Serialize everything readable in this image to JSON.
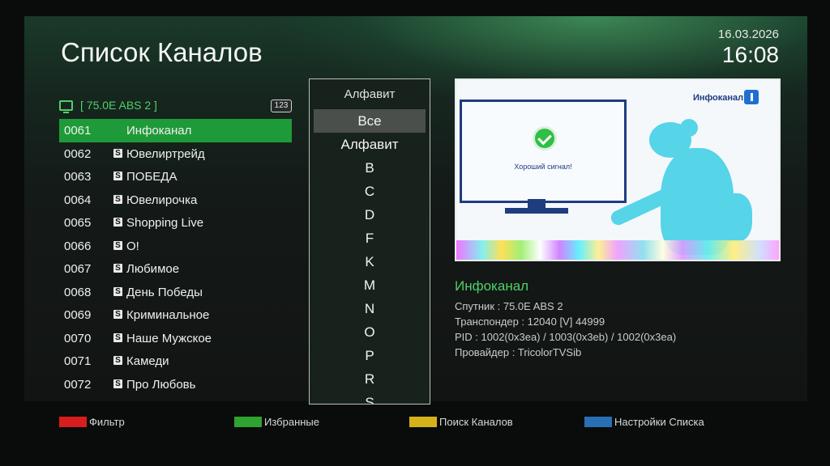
{
  "header": {
    "title": "Список Каналов",
    "date": "16.03.2026",
    "time": "16:08"
  },
  "satellite": {
    "label": "[ 75.0E ABS 2 ]",
    "badge": "123"
  },
  "channels": [
    {
      "num": "0061",
      "name": "Инфоканал",
      "scrambled": false,
      "selected": true
    },
    {
      "num": "0062",
      "name": "Ювелиртрейд",
      "scrambled": true
    },
    {
      "num": "0063",
      "name": "ПОБЕДА",
      "scrambled": true
    },
    {
      "num": "0064",
      "name": "Ювелирочка",
      "scrambled": true
    },
    {
      "num": "0065",
      "name": "Shopping Live",
      "scrambled": true
    },
    {
      "num": "0066",
      "name": "О!",
      "scrambled": true
    },
    {
      "num": "0067",
      "name": "Любимое",
      "scrambled": true
    },
    {
      "num": "0068",
      "name": "День Победы",
      "scrambled": true
    },
    {
      "num": "0069",
      "name": "Криминальное",
      "scrambled": true
    },
    {
      "num": "0070",
      "name": "Наше Мужское",
      "scrambled": true
    },
    {
      "num": "0071",
      "name": "Камеди",
      "scrambled": true
    },
    {
      "num": "0072",
      "name": "Про Любовь",
      "scrambled": true
    }
  ],
  "scramble_icon_label": "S",
  "alphabet": {
    "title": "Алфавит",
    "items": [
      "Все",
      "Алфавит",
      "B",
      "C",
      "D",
      "F",
      "K",
      "M",
      "N",
      "O",
      "P",
      "R",
      "S"
    ],
    "selected_index": 0
  },
  "preview": {
    "logo_text": "Инфоканал",
    "signal_text": "Хороший сигнал!"
  },
  "channel_info": {
    "name": "Инфоканал",
    "satellite": "Спутник : 75.0E ABS 2",
    "transponder": "Транспондер : 12040 [V] 44999",
    "pid": "PID : 1002(0x3ea) / 1003(0x3eb) / 1002(0x3ea)",
    "provider": "Провайдер : TricolorTVSib"
  },
  "footer": [
    {
      "label": "Фильтр",
      "color": "#d61e1e"
    },
    {
      "label": "Избранные",
      "color": "#2fa32f"
    },
    {
      "label": "Поиск Каналов",
      "color": "#d6b21a"
    },
    {
      "label": "Настройки Списка",
      "color": "#2a6fb4"
    }
  ],
  "colors": {
    "accent_green": "#4fd06a",
    "selection_green": "#1f9a39"
  }
}
